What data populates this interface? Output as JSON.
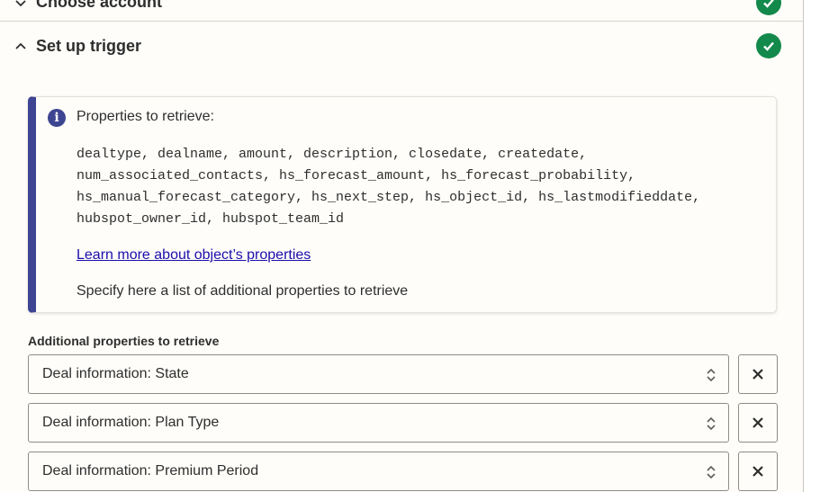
{
  "sections": {
    "previous": {
      "title": "Choose account",
      "complete_icon": "check-circle-icon"
    },
    "current": {
      "title": "Set up trigger",
      "complete_icon": "check-circle-icon"
    }
  },
  "info": {
    "icon": "info-icon",
    "title": "Properties to retrieve:",
    "code": "dealtype, dealname, amount, description, closedate, createdate,\nnum_associated_contacts, hs_forecast_amount, hs_forecast_probability,\nhs_manual_forecast_category, hs_next_step, hs_object_id, hs_lastmodifieddate,\nhubspot_owner_id, hubspot_team_id",
    "link": "Learn more about object’s properties",
    "note": "Specify here a list of additional properties to retrieve"
  },
  "additional": {
    "label": "Additional properties to retrieve",
    "items": [
      {
        "value": "Deal information: State"
      },
      {
        "value": "Deal information: Plan Type"
      },
      {
        "value": "Deal information: Premium Period"
      }
    ]
  },
  "colors": {
    "accent": "#3d4592",
    "success": "#138a4b",
    "link": "#1a0dab"
  }
}
